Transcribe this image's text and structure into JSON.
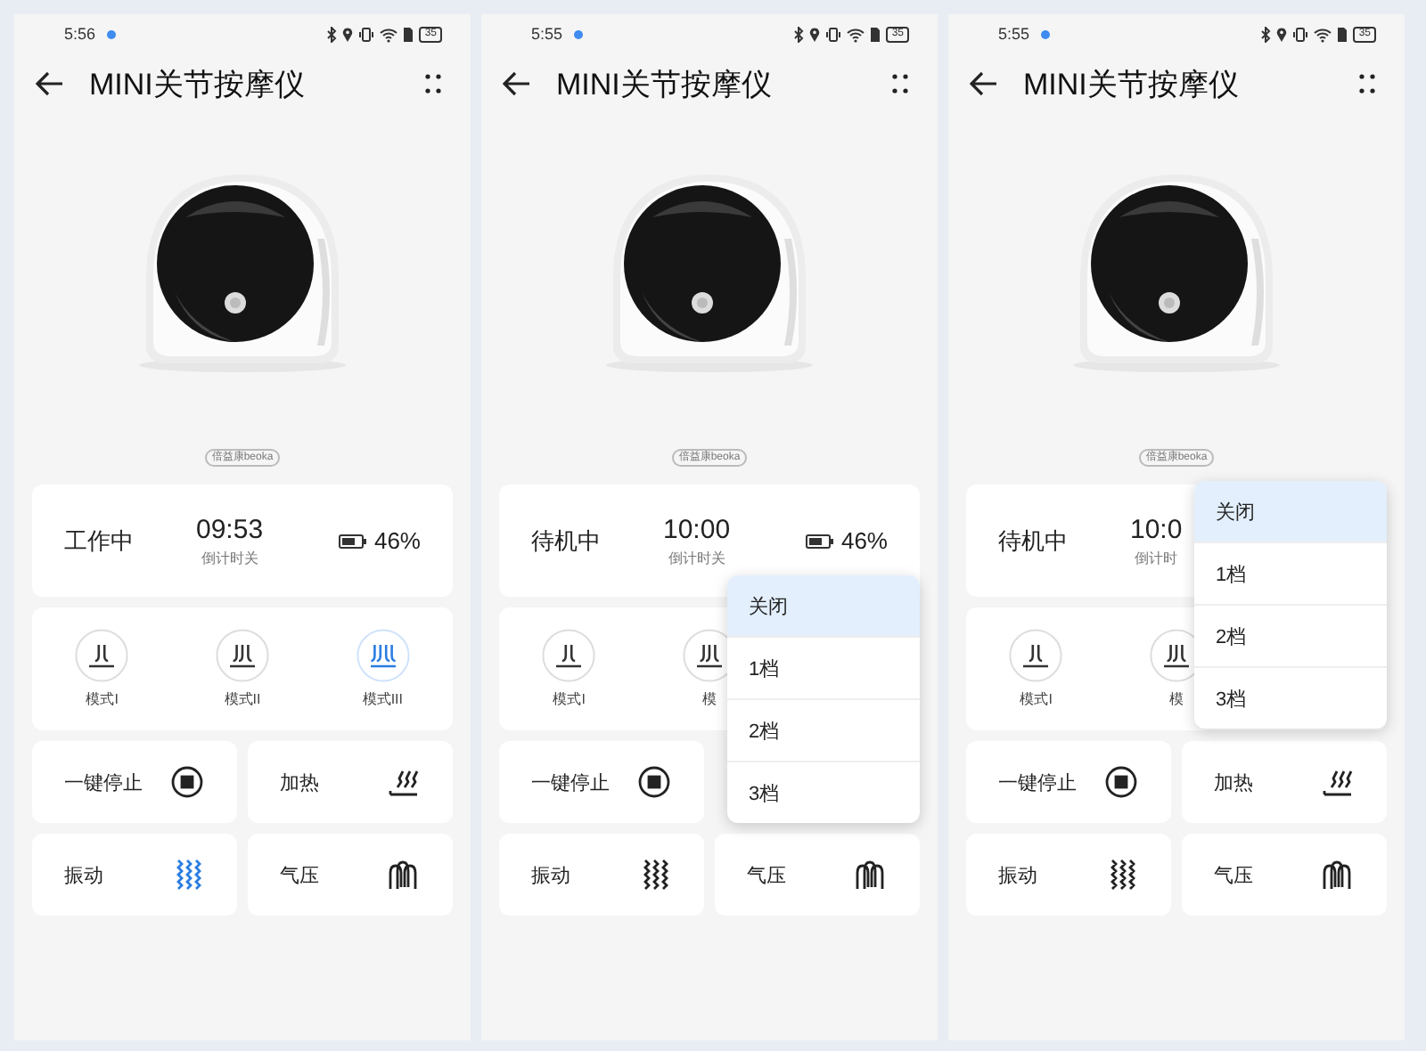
{
  "screens": [
    {
      "status_bar": {
        "time": "5:56",
        "battery": "35"
      },
      "title": "MINI关节按摩仪",
      "logo": "倍益康beoka",
      "status_card": {
        "state": "工作中",
        "timer": "09:53",
        "timer_label": "倒计时关",
        "battery": "46%"
      },
      "mode_card": {
        "modes": [
          {
            "label": "模式I",
            "selected": false
          },
          {
            "label": "模式II",
            "selected": false
          },
          {
            "label": "模式III",
            "selected": true
          }
        ]
      },
      "action_rows": [
        [
          {
            "label": "一键停止",
            "kind": "stop",
            "active": false
          },
          {
            "label": "加热",
            "kind": "heat",
            "active": false
          }
        ],
        [
          {
            "label": "振动",
            "kind": "vibrate",
            "active": true
          },
          {
            "label": "气压",
            "kind": "pressure",
            "active": false
          }
        ]
      ]
    },
    {
      "status_bar": {
        "time": "5:55",
        "battery": "35"
      },
      "title": "MINI关节按摩仪",
      "logo": "倍益康beoka",
      "status_card": {
        "state": "待机中",
        "timer": "10:00",
        "timer_label": "倒计时关",
        "battery": "46%"
      },
      "mode_card": {
        "modes": [
          {
            "label": "模式I",
            "selected": false
          },
          {
            "label": "模",
            "selected": false
          }
        ],
        "dropdown": {
          "items": [
            {
              "label": "关闭",
              "selected": true
            },
            {
              "label": "1档",
              "selected": false
            },
            {
              "label": "2档",
              "selected": false
            },
            {
              "label": "3档",
              "selected": false
            }
          ]
        }
      },
      "action_rows": [
        [
          {
            "label": "一键停止",
            "kind": "stop",
            "active": false
          }
        ],
        [
          {
            "label": "振动",
            "kind": "vibrate",
            "active": false
          },
          {
            "label": "气压",
            "kind": "pressure",
            "active": false
          }
        ]
      ]
    },
    {
      "status_bar": {
        "time": "5:55",
        "battery": "35"
      },
      "title": "MINI关节按摩仪",
      "logo": "倍益康beoka",
      "status_card": {
        "state": "待机中",
        "timer": "10:0",
        "timer_label": "倒计时",
        "dropdown": {
          "items": [
            {
              "label": "关闭",
              "selected": true
            },
            {
              "label": "1档",
              "selected": false
            },
            {
              "label": "2档",
              "selected": false
            },
            {
              "label": "3档",
              "selected": false
            }
          ]
        }
      },
      "mode_card": {
        "modes": [
          {
            "label": "模式I",
            "selected": false
          },
          {
            "label": "模",
            "selected": false
          }
        ]
      },
      "action_rows": [
        [
          {
            "label": "一键停止",
            "kind": "stop",
            "active": false
          },
          {
            "label": "加热",
            "kind": "heat",
            "active": false
          }
        ],
        [
          {
            "label": "振动",
            "kind": "vibrate",
            "active": false
          },
          {
            "label": "气压",
            "kind": "pressure",
            "active": false
          }
        ]
      ]
    }
  ]
}
